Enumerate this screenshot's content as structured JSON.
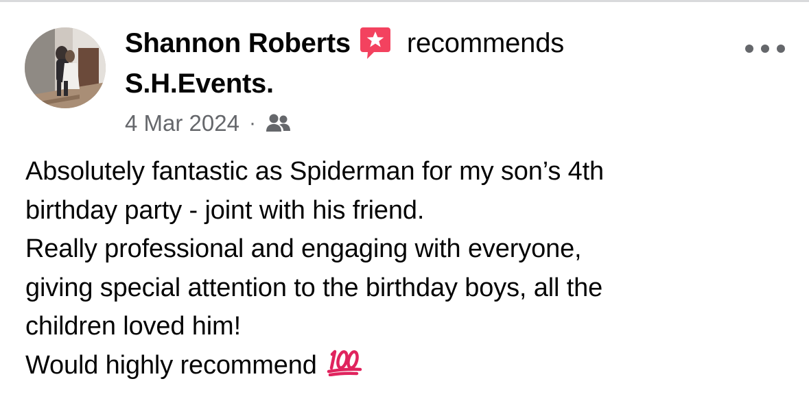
{
  "post": {
    "author": "Shannon Roberts",
    "action": "recommends",
    "page_name": "S.H.Events.",
    "date": "4 Mar 2024",
    "separator": "·",
    "audience_icon": "friends-icon",
    "badge_icon": "recommendation-star-icon",
    "more_icon": "more-options-icon",
    "body_lines": [
      "Absolutely fantastic as Spiderman for my son’s 4th",
      "birthday party - joint with his friend.",
      "Really professional and engaging with everyone,",
      "giving special attention to the birthday boys, all the",
      "children loved him!",
      "Would highly recommend"
    ],
    "emoji": "hundred-points-emoji"
  },
  "colors": {
    "text": "#050505",
    "secondary_text": "#65676b",
    "badge": "#f3425f",
    "emoji": "#e0245e"
  }
}
